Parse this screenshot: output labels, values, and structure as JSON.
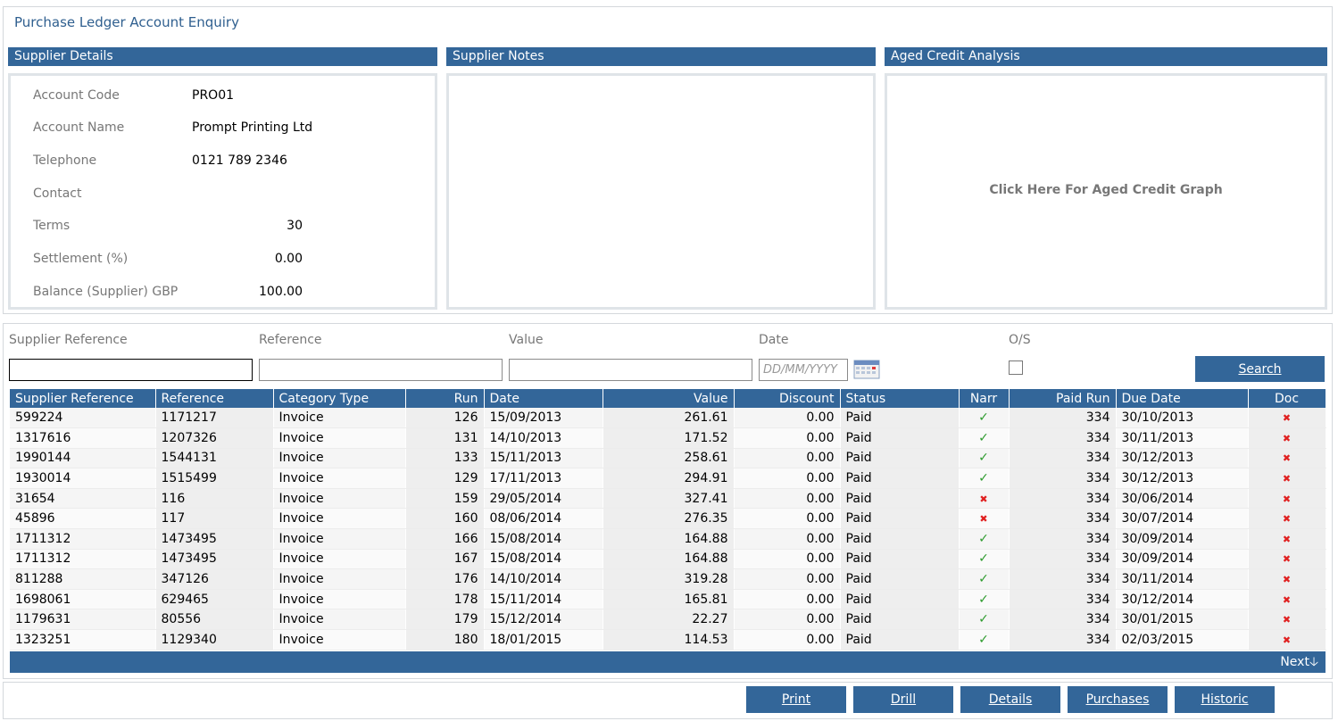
{
  "page": {
    "title": "Purchase Ledger Account Enquiry"
  },
  "supplier_details": {
    "header": "Supplier Details",
    "account_code_label": "Account Code",
    "account_code": "PRO01",
    "account_name_label": "Account Name",
    "account_name": "Prompt Printing Ltd",
    "telephone_label": "Telephone",
    "telephone": "0121 789 2346",
    "contact_label": "Contact",
    "contact": "",
    "terms_label": "Terms",
    "terms": "30",
    "settlement_label": "Settlement (%)",
    "settlement": "0.00",
    "balance_label": "Balance (Supplier) GBP",
    "balance": "100.00"
  },
  "supplier_notes": {
    "header": "Supplier Notes"
  },
  "aged_credit": {
    "header": "Aged Credit Analysis",
    "link": "Click Here For Aged Credit Graph"
  },
  "filters": {
    "supplier_reference_label": "Supplier Reference",
    "reference_label": "Reference",
    "value_label": "Value",
    "date_label": "Date",
    "date_placeholder": "DD/MM/YYYY",
    "os_label": "O/S",
    "search_button": "Search"
  },
  "grid": {
    "columns": [
      "Supplier Reference",
      "Reference",
      "Category Type",
      "Run",
      "Date",
      "Value",
      "Discount",
      "Status",
      "Narr",
      "Paid Run",
      "Due Date",
      "Doc"
    ],
    "rows": [
      {
        "supplier_ref": "599224",
        "ref": "1171217",
        "category": "Invoice",
        "run": "126",
        "date": "15/09/2013",
        "value": "261.61",
        "discount": "0.00",
        "status": "Paid",
        "narr": "tick",
        "paid_run": "334",
        "due_date": "30/10/2013",
        "doc": "cross"
      },
      {
        "supplier_ref": "1317616",
        "ref": "1207326",
        "category": "Invoice",
        "run": "131",
        "date": "14/10/2013",
        "value": "171.52",
        "discount": "0.00",
        "status": "Paid",
        "narr": "tick",
        "paid_run": "334",
        "due_date": "30/11/2013",
        "doc": "cross"
      },
      {
        "supplier_ref": "1990144",
        "ref": "1544131",
        "category": "Invoice",
        "run": "133",
        "date": "15/11/2013",
        "value": "258.61",
        "discount": "0.00",
        "status": "Paid",
        "narr": "tick",
        "paid_run": "334",
        "due_date": "30/12/2013",
        "doc": "cross"
      },
      {
        "supplier_ref": "1930014",
        "ref": "1515499",
        "category": "Invoice",
        "run": "129",
        "date": "17/11/2013",
        "value": "294.91",
        "discount": "0.00",
        "status": "Paid",
        "narr": "tick",
        "paid_run": "334",
        "due_date": "30/12/2013",
        "doc": "cross"
      },
      {
        "supplier_ref": "31654",
        "ref": "116",
        "category": "Invoice",
        "run": "159",
        "date": "29/05/2014",
        "value": "327.41",
        "discount": "0.00",
        "status": "Paid",
        "narr": "cross",
        "paid_run": "334",
        "due_date": "30/06/2014",
        "doc": "cross"
      },
      {
        "supplier_ref": "45896",
        "ref": "117",
        "category": "Invoice",
        "run": "160",
        "date": "08/06/2014",
        "value": "276.35",
        "discount": "0.00",
        "status": "Paid",
        "narr": "cross",
        "paid_run": "334",
        "due_date": "30/07/2014",
        "doc": "cross"
      },
      {
        "supplier_ref": "1711312",
        "ref": "1473495",
        "category": "Invoice",
        "run": "166",
        "date": "15/08/2014",
        "value": "164.88",
        "discount": "0.00",
        "status": "Paid",
        "narr": "tick",
        "paid_run": "334",
        "due_date": "30/09/2014",
        "doc": "cross"
      },
      {
        "supplier_ref": "1711312",
        "ref": "1473495",
        "category": "Invoice",
        "run": "167",
        "date": "15/08/2014",
        "value": "164.88",
        "discount": "0.00",
        "status": "Paid",
        "narr": "tick",
        "paid_run": "334",
        "due_date": "30/09/2014",
        "doc": "cross"
      },
      {
        "supplier_ref": "811288",
        "ref": "347126",
        "category": "Invoice",
        "run": "176",
        "date": "14/10/2014",
        "value": "319.28",
        "discount": "0.00",
        "status": "Paid",
        "narr": "tick",
        "paid_run": "334",
        "due_date": "30/11/2014",
        "doc": "cross"
      },
      {
        "supplier_ref": "1698061",
        "ref": "629465",
        "category": "Invoice",
        "run": "178",
        "date": "15/11/2014",
        "value": "165.81",
        "discount": "0.00",
        "status": "Paid",
        "narr": "tick",
        "paid_run": "334",
        "due_date": "30/12/2014",
        "doc": "cross"
      },
      {
        "supplier_ref": "1179631",
        "ref": "80556",
        "category": "Invoice",
        "run": "179",
        "date": "15/12/2014",
        "value": "22.27",
        "discount": "0.00",
        "status": "Paid",
        "narr": "tick",
        "paid_run": "334",
        "due_date": "30/01/2015",
        "doc": "cross"
      },
      {
        "supplier_ref": "1323251",
        "ref": "1129340",
        "category": "Invoice",
        "run": "180",
        "date": "18/01/2015",
        "value": "114.53",
        "discount": "0.00",
        "status": "Paid",
        "narr": "tick",
        "paid_run": "334",
        "due_date": "02/03/2015",
        "doc": "cross"
      }
    ],
    "next_label": "Next"
  },
  "actions": {
    "print": "Print",
    "drill": "Drill",
    "details": "Details",
    "purchases": "Purchases",
    "historic": "Historic"
  },
  "colors": {
    "header_blue": "#336699",
    "tick_green": "#2e9b2e",
    "cross_red": "#e02020"
  }
}
